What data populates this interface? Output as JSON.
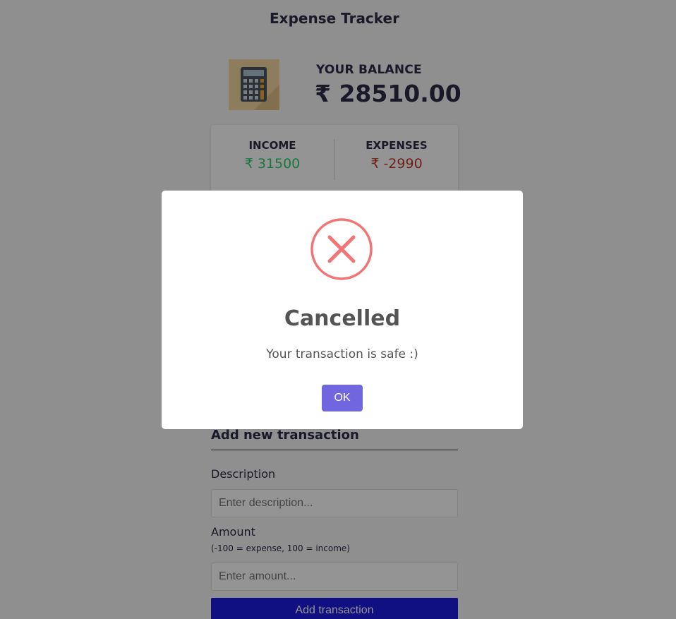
{
  "app": {
    "title": "Expense Tracker"
  },
  "balance": {
    "label": "YOUR BALANCE",
    "value": "₹ 28510.00"
  },
  "summary": {
    "income_label": "INCOME",
    "income_value": "₹ 31500",
    "expense_label": "EXPENSES",
    "expense_value": "₹ -2990"
  },
  "form": {
    "heading": "Add new transaction",
    "description_label": "Description",
    "description_placeholder": "Enter description...",
    "amount_label": "Amount",
    "amount_hint": "(-100 = expense, 100 = income)",
    "amount_placeholder": "Enter amount...",
    "submit_label": "Add transaction"
  },
  "modal": {
    "title": "Cancelled",
    "text": "Your transaction is safe :)",
    "ok_label": "OK",
    "icon": "error-x-icon"
  },
  "colors": {
    "income": "#2ecc71",
    "expense": "#c0392b",
    "error_icon": "#f27474",
    "ok_button": "#7066e0",
    "submit_button": "#1d1de0"
  }
}
